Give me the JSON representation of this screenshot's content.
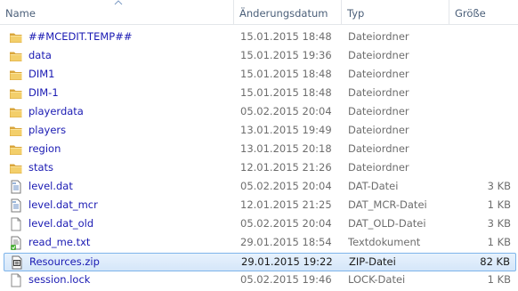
{
  "columns": {
    "name": "Name",
    "date": "Änderungsdatum",
    "type": "Typ",
    "size": "Größe"
  },
  "rows": [
    {
      "name": "##MCEDIT.TEMP##",
      "date": "15.01.2015 18:48",
      "type": "Dateiordner",
      "size": "",
      "icon": "folder-icon"
    },
    {
      "name": "data",
      "date": "15.01.2015 19:36",
      "type": "Dateiordner",
      "size": "",
      "icon": "folder-icon"
    },
    {
      "name": "DIM1",
      "date": "15.01.2015 18:48",
      "type": "Dateiordner",
      "size": "",
      "icon": "folder-icon"
    },
    {
      "name": "DIM-1",
      "date": "15.01.2015 18:48",
      "type": "Dateiordner",
      "size": "",
      "icon": "folder-icon"
    },
    {
      "name": "playerdata",
      "date": "05.02.2015 20:04",
      "type": "Dateiordner",
      "size": "",
      "icon": "folder-icon"
    },
    {
      "name": "players",
      "date": "13.01.2015 19:49",
      "type": "Dateiordner",
      "size": "",
      "icon": "folder-icon"
    },
    {
      "name": "region",
      "date": "13.01.2015 20:18",
      "type": "Dateiordner",
      "size": "",
      "icon": "folder-icon"
    },
    {
      "name": "stats",
      "date": "12.01.2015 21:26",
      "type": "Dateiordner",
      "size": "",
      "icon": "folder-icon"
    },
    {
      "name": "level.dat",
      "date": "05.02.2015 20:04",
      "type": "DAT-Datei",
      "size": "3 KB",
      "icon": "document-icon"
    },
    {
      "name": "level.dat_mcr",
      "date": "12.01.2015 21:25",
      "type": "DAT_MCR-Datei",
      "size": "1 KB",
      "icon": "document-icon"
    },
    {
      "name": "level.dat_old",
      "date": "05.02.2015 20:04",
      "type": "DAT_OLD-Datei",
      "size": "3 KB",
      "icon": "blank-file-icon"
    },
    {
      "name": "read_me.txt",
      "date": "29.01.2015 18:54",
      "type": "Textdokument",
      "size": "1 KB",
      "icon": "text-file-icon"
    },
    {
      "name": "Resources.zip",
      "date": "29.01.2015 19:22",
      "type": "ZIP-Datei",
      "size": "82 KB",
      "icon": "zip-file-icon",
      "selected": true
    },
    {
      "name": "session.lock",
      "date": "05.02.2015 19:46",
      "type": "LOCK-Datei",
      "size": "1 KB",
      "icon": "blank-file-icon"
    }
  ],
  "colors": {
    "name_text": "#1a1ab3",
    "meta_text": "#6d6d6d",
    "header_text": "#4c607a",
    "selection_border": "#7eb4ea",
    "folder": "#e8b84a"
  }
}
